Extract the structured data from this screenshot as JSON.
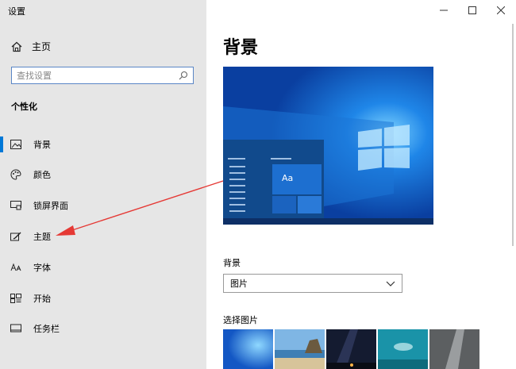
{
  "window": {
    "title": "设置"
  },
  "sidebar": {
    "home_label": "主页",
    "search_placeholder": "查找设置",
    "section_title": "个性化",
    "items": [
      {
        "label": "背景",
        "icon": "image-icon",
        "active": true
      },
      {
        "label": "颜色",
        "icon": "palette-icon"
      },
      {
        "label": "锁屏界面",
        "icon": "lock-screen-icon"
      },
      {
        "label": "主题",
        "icon": "theme-brush-icon"
      },
      {
        "label": "字体",
        "icon": "font-icon"
      },
      {
        "label": "开始",
        "icon": "start-menu-icon"
      },
      {
        "label": "任务栏",
        "icon": "taskbar-icon"
      }
    ]
  },
  "main": {
    "title": "背景",
    "preview": {
      "sample_text": "Aa"
    },
    "background_label": "背景",
    "background_value": "图片",
    "choose_picture_label": "选择图片"
  },
  "colors": {
    "accent": "#0078d7",
    "sidebar_bg": "#e6e6e6",
    "annotation_arrow": "#e53935"
  }
}
